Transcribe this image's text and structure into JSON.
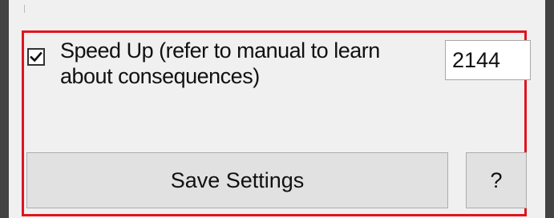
{
  "settings": {
    "speed_up": {
      "checked": true,
      "label": "Speed Up (refer to manual to learn about consequences)",
      "value": "2144"
    },
    "buttons": {
      "save_label": "Save Settings",
      "help_label": "?"
    },
    "highlight_color": "#e2141c"
  }
}
